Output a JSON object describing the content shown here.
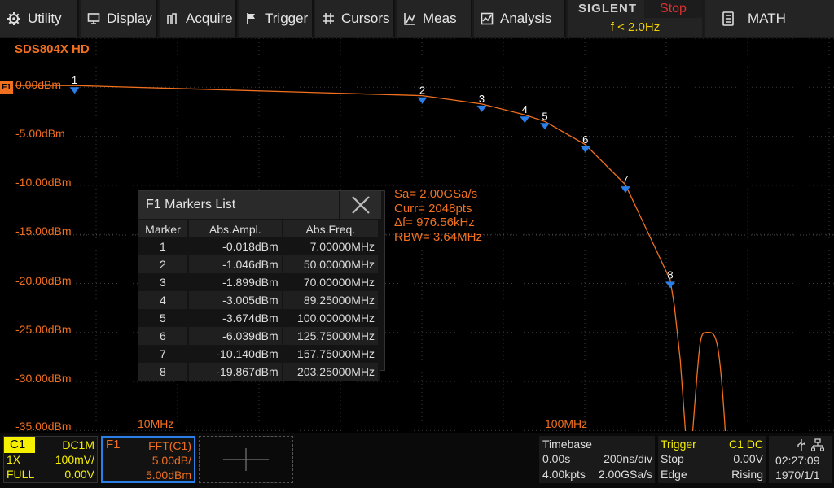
{
  "menu": {
    "utility": "Utility",
    "display": "Display",
    "acquire": "Acquire",
    "trigger": "Trigger",
    "cursors": "Cursors",
    "meas": "Meas",
    "analysis": "Analysis",
    "math": "MATH"
  },
  "brand": {
    "name": "SIGLENT",
    "run_state": "Stop",
    "trigger_freq": "f < 2.0Hz"
  },
  "screen": {
    "model": "SDS804X HD",
    "trace_tag": "F1",
    "y_labels": [
      "0.00dBm",
      "-5.00dBm",
      "-10.00dBm",
      "-15.00dBm",
      "-20.00dBm",
      "-25.00dBm",
      "-30.00dBm",
      "-35.00dBm"
    ],
    "x_labels": [
      "10MHz",
      "100MHz"
    ],
    "marker_ids": [
      "1",
      "2",
      "3",
      "4",
      "5",
      "6",
      "7",
      "8"
    ],
    "trace_color": "#f07020",
    "marker_color": "#2a7ee8"
  },
  "fft_info": {
    "sa": "Sa= 2.00GSa/s",
    "curr": "Curr= 2048pts",
    "df": "Δf= 976.56kHz",
    "rbw": "RBW= 3.64MHz"
  },
  "markers_list": {
    "title": "F1 Markers List",
    "columns": [
      "Marker",
      "Abs.Ampl.",
      "Abs.Freq."
    ],
    "rows": [
      [
        "1",
        "-0.018dBm",
        "7.00000MHz"
      ],
      [
        "2",
        "-1.046dBm",
        "50.00000MHz"
      ],
      [
        "3",
        "-1.899dBm",
        "70.00000MHz"
      ],
      [
        "4",
        "-3.005dBm",
        "89.25000MHz"
      ],
      [
        "5",
        "-3.674dBm",
        "100.00000MHz"
      ],
      [
        "6",
        "-6.039dBm",
        "125.75000MHz"
      ],
      [
        "7",
        "-10.140dBm",
        "157.75000MHz"
      ],
      [
        "8",
        "-19.867dBm",
        "203.25000MHz"
      ]
    ]
  },
  "channel1": {
    "name": "C1",
    "coupling": "DC1M",
    "probe": "1X",
    "scale": "100mV/",
    "bw": "FULL",
    "offset": "0.00V"
  },
  "f1": {
    "name": "F1",
    "func": "FFT(C1)",
    "scale": "5.00dB/",
    "ref": "5.00dBm"
  },
  "timebase": {
    "title": "Timebase",
    "delay": "0.00s",
    "scale": "200ns/div",
    "points": "4.00kpts",
    "rate": "2.00GSa/s"
  },
  "trigger": {
    "title": "Trigger",
    "source": "C1 DC",
    "state": "Stop",
    "level": "0.00V",
    "type": "Edge",
    "slope": "Rising"
  },
  "clock": {
    "time": "02:27:09",
    "date": "1970/1/1"
  }
}
